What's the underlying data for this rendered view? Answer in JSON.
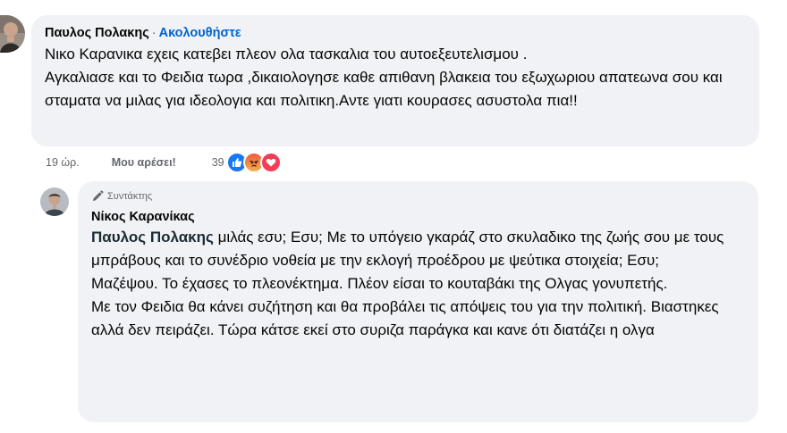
{
  "comment": {
    "author": "Παυλος Πολακης",
    "separator": "·",
    "follow_label": "Ακολουθήστε",
    "text": "Νικο Καρανικα εχεις κατεβει πλεον ολα τασκαλια του αυτοεξευτελισμου .\nΑγκαλιασε και το Φειδια τωρα ,δικαιολογησε καθε απιθανη βλακεια του εξωχωριου απατεωνα σου και σταματα να μιλας για ιδεολογια και πολιτικη.Αντε γιατι κουρασες ασυστολα πια!!",
    "time": "19 ώρ.",
    "like_label": "Μου αρέσει!",
    "reaction_count": "39",
    "reactions": [
      "like-reaction",
      "angry-reaction",
      "love-reaction"
    ]
  },
  "reply": {
    "badge": "Συντάκτης",
    "author": "Νίκος Καρανίκας",
    "mention": "Παυλος Πολακης",
    "text": "μιλάς εσυ; Εσυ; Με το υπόγειο γκαράζ στο σκυλαδικο της ζωής σου με τους μπράβους και το συνέδριο νοθεία με την εκλογή προέδρου με ψεύτικα στοιχεία; Εσυ;\nΜαζέψου. Το έχασες το πλεονέκτημα. Πλέον είσαι το κουταβάκι της Ολγας γονυπετής.\nΜε τον Φειδια θα κάνει συζήτηση και θα προβάλει τις απόψεις του για την πολιτική. Βιαστηκες αλλά δεν πειράζει. Τώρα κάτσε εκεί στο συριζα παράγκα και κανε ότι διατάζει η ολγα"
  },
  "colors": {
    "bubble": "#f0f2f5",
    "link": "#0064d1",
    "meta": "#65676b",
    "like": "#1877f2",
    "angry": "#f0643c",
    "love": "#f33e58"
  }
}
